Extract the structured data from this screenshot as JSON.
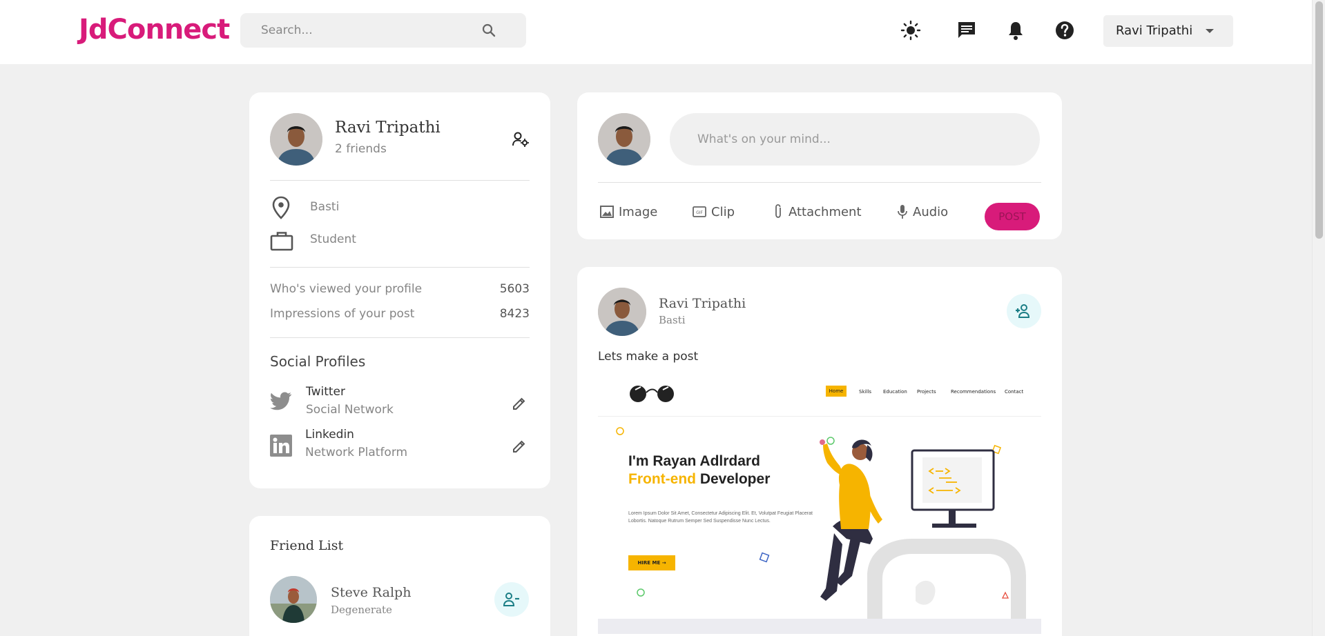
{
  "app": {
    "logo": "JdConnect"
  },
  "navbar": {
    "search_placeholder": "Search...",
    "user_menu_label": "Ravi Tripathi",
    "icons": [
      "sun-icon",
      "message-icon",
      "bell-icon",
      "help-icon",
      "search-icon",
      "chevron-down-icon"
    ]
  },
  "profile": {
    "name": "Ravi Tripathi",
    "friends": "2 friends",
    "location": "Basti",
    "occupation": "Student",
    "stats": [
      {
        "label": "Who's viewed your profile",
        "value": "5603"
      },
      {
        "label": "Impressions of your post",
        "value": "8423"
      }
    ],
    "social_title": "Social Profiles",
    "social": [
      {
        "name": "Twitter",
        "sub": "Social Network"
      },
      {
        "name": "Linkedin",
        "sub": "Network Platform"
      }
    ]
  },
  "composer": {
    "placeholder": "What's on your mind...",
    "actions": [
      "Image",
      "Clip",
      "Attachment",
      "Audio"
    ],
    "post_label": "POST"
  },
  "post": {
    "author": "Ravi Tripathi",
    "location": "Basti",
    "text": "Lets make a post",
    "image": {
      "nav": [
        "Home",
        "Skills",
        "Education",
        "Projects",
        "Recommendations",
        "Contact"
      ],
      "headline_1": "I'm Rayan Adlrdard",
      "headline_2_accent": "Front-end",
      "headline_2_rest": " Developer",
      "lorem": "Lorem Ipsum Dolor Sit Amet, Consectetur Adipiscing Elit. Et, Volutpat Feugiat Placerat Lobortis. Natoque Rutrum Semper Sed Suspendisse Nunc Lectus.",
      "cta": "HIRE ME →"
    }
  },
  "friend_list": {
    "title": "Friend List",
    "friends": [
      {
        "name": "Steve Ralph",
        "sub": "Degenerate"
      }
    ]
  },
  "colors": {
    "brand": "#d81b7a",
    "accent_cyan": "#e6f8fa",
    "mock_yellow": "#f6b400"
  }
}
